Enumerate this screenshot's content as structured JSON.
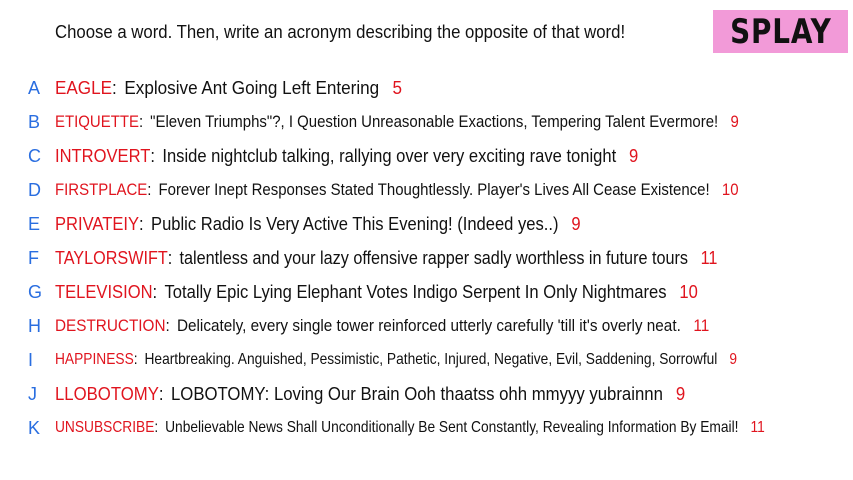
{
  "brand": {
    "logo_text": "SPLAY"
  },
  "instructions": "Choose a word. Then, write an acronym describing the opposite of that word!",
  "colors": {
    "letter": "#2a6ee0",
    "word": "#e0141e",
    "count": "#e0141e",
    "logo_bg": "#f29ad8"
  },
  "entries": [
    {
      "letter": "A",
      "word": "EAGLE",
      "acronym": "Explosive Ant Going Left Entering",
      "count": "5"
    },
    {
      "letter": "B",
      "word": "ETIQUETTE",
      "acronym": "\"Eleven Triumphs\"?, I Question Unreasonable Exactions, Tempering Talent Evermore!",
      "count": "9"
    },
    {
      "letter": "C",
      "word": "INTROVERT",
      "acronym": "Inside nightclub talking, rallying over very exciting rave tonight",
      "count": "9"
    },
    {
      "letter": "D",
      "word": "FIRSTPLACE",
      "acronym": "Forever Inept Responses Stated Thoughtlessly. Player's Lives All Cease Existence!",
      "count": "10"
    },
    {
      "letter": "E",
      "word": "PRIVATEIY",
      "acronym": "Public Radio Is Very Active This Evening! (Indeed yes..)",
      "count": "9"
    },
    {
      "letter": "F",
      "word": "TAYLORSWIFT",
      "acronym": "talentless and your lazy offensive rapper sadly worthless in future tours",
      "count": "11"
    },
    {
      "letter": "G",
      "word": "TELEVISION",
      "acronym": "Totally Epic Lying Elephant Votes Indigo Serpent In Only Nightmares",
      "count": "10"
    },
    {
      "letter": "H",
      "word": "DESTRUCTION",
      "acronym": "Delicately, every single tower reinforced utterly carefully 'till it's overly neat.",
      "count": "11"
    },
    {
      "letter": "I",
      "word": "HAPPINESS",
      "acronym": "Heartbreaking. Anguished, Pessimistic, Pathetic, Injured, Negative, Evil, Saddening, Sorrowful",
      "count": "9"
    },
    {
      "letter": "J",
      "word": "LLOBOTOMY",
      "acronym": "LOBOTOMY: Loving Our Brain Ooh thaatss ohh mmyyy yubrainnn",
      "count": "9"
    },
    {
      "letter": "K",
      "word": "UNSUBSCRIBE",
      "acronym": "Unbelievable News Shall Unconditionally Be Sent Constantly, Revealing Information By Email!",
      "count": "11"
    }
  ]
}
